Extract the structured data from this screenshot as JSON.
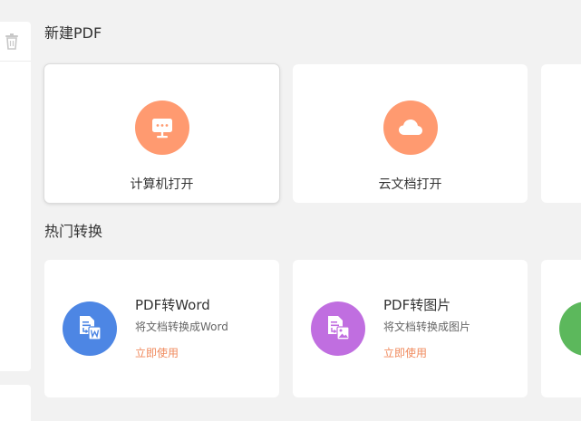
{
  "sections": {
    "new_pdf_title": "新建PDF",
    "hot_convert_title": "热门转换"
  },
  "open_cards": [
    {
      "label": "计算机打开",
      "icon": "computer-icon"
    },
    {
      "label": "云文档打开",
      "icon": "cloud-icon"
    }
  ],
  "convert_cards": [
    {
      "title": "PDF转Word",
      "desc": "将文档转换成Word",
      "action": "立即使用",
      "icon": "pdf-to-word-icon",
      "color": "#4d86e4"
    },
    {
      "title": "PDF转图片",
      "desc": "将文档转换成图片",
      "action": "立即使用",
      "icon": "pdf-to-image-icon",
      "color": "#c06ee0"
    },
    {
      "icon": "pdf-convert-icon",
      "color": "#5cb85c"
    }
  ],
  "colors": {
    "accent_orange": "#ff9a70",
    "action_text": "#f08a5d",
    "background": "#f2f2f2"
  },
  "left_panel": {
    "icon": "trash-icon"
  }
}
